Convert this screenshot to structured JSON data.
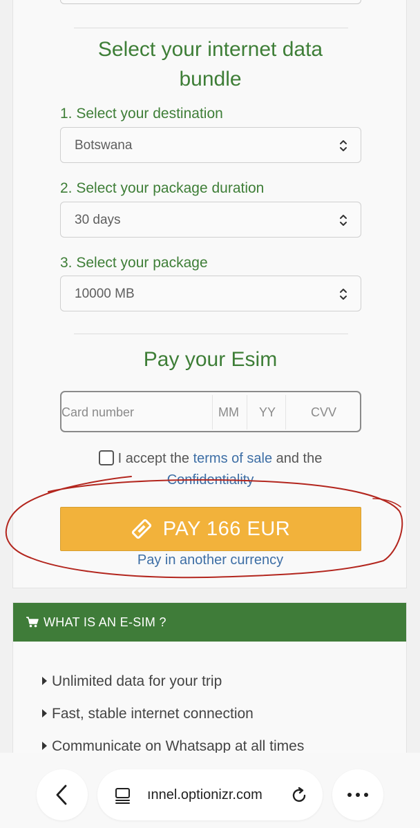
{
  "bundle": {
    "title_line1": "Select your internet data",
    "title_line2": "bundle",
    "destination": {
      "label": "1. Select your destination",
      "value": "Botswana"
    },
    "duration": {
      "label": "2. Select your package duration",
      "value": "30 days"
    },
    "package": {
      "label": "3. Select your package",
      "value": "10000 MB"
    }
  },
  "payment": {
    "title": "Pay your Esim",
    "card_number_placeholder": "Card number",
    "mm_placeholder": "MM",
    "yy_placeholder": "YY",
    "cvv_placeholder": "CVV",
    "accept_prefix": "I accept the ",
    "terms_link": "terms of sale",
    "accept_middle": " and the",
    "confidentiality_link": "Confidentiality",
    "pay_button": "PAY 166 EUR",
    "other_currency": "Pay in another currency"
  },
  "esim_info": {
    "heading": "WHAT IS AN E-SIM ?",
    "items": [
      "Unlimited data for your trip",
      "Fast, stable internet connection",
      "Communicate on Whatsapp at all times"
    ]
  },
  "browser": {
    "url": "ınnel.optionizr.com",
    "icons": [
      "back-icon",
      "tabs-icon",
      "reload-icon",
      "more-icon"
    ]
  },
  "colors": {
    "green": "#3e7e37",
    "pay_button": "#f2b23b",
    "link": "#3d6ea5",
    "annotation": "#b3261e"
  }
}
